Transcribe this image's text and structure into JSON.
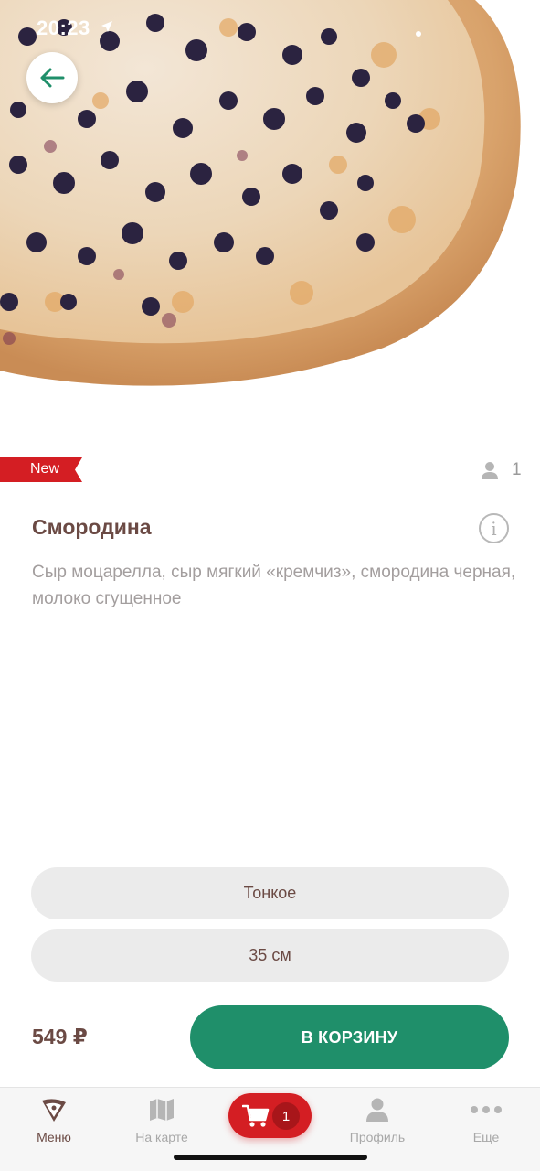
{
  "status_bar": {
    "time": "20:23"
  },
  "product": {
    "badge": "New",
    "persons": "1",
    "title": "Смородина",
    "description": "Сыр моцарелла, сыр мягкий «кремчиз», смородина черная, молоко сгущенное",
    "options": {
      "crust": "Тонкое",
      "size": "35 см"
    },
    "price": "549 ₽",
    "add_to_cart_label": "В КОРЗИНУ"
  },
  "tabbar": {
    "items": [
      {
        "label": "Меню",
        "icon": "pizza-slice-icon",
        "active": true
      },
      {
        "label": "На карте",
        "icon": "map-icon",
        "active": false
      },
      {
        "label": "",
        "icon": "cart-icon",
        "active": false
      },
      {
        "label": "Профиль",
        "icon": "person-icon",
        "active": false
      },
      {
        "label": "Еще",
        "icon": "more-dots-icon",
        "active": false
      }
    ],
    "cart_count": "1"
  },
  "colors": {
    "brand_green": "#1f8f6a",
    "brand_red": "#d41e23",
    "text_brown": "#6b4a44",
    "option_bg": "#ebebeb"
  }
}
